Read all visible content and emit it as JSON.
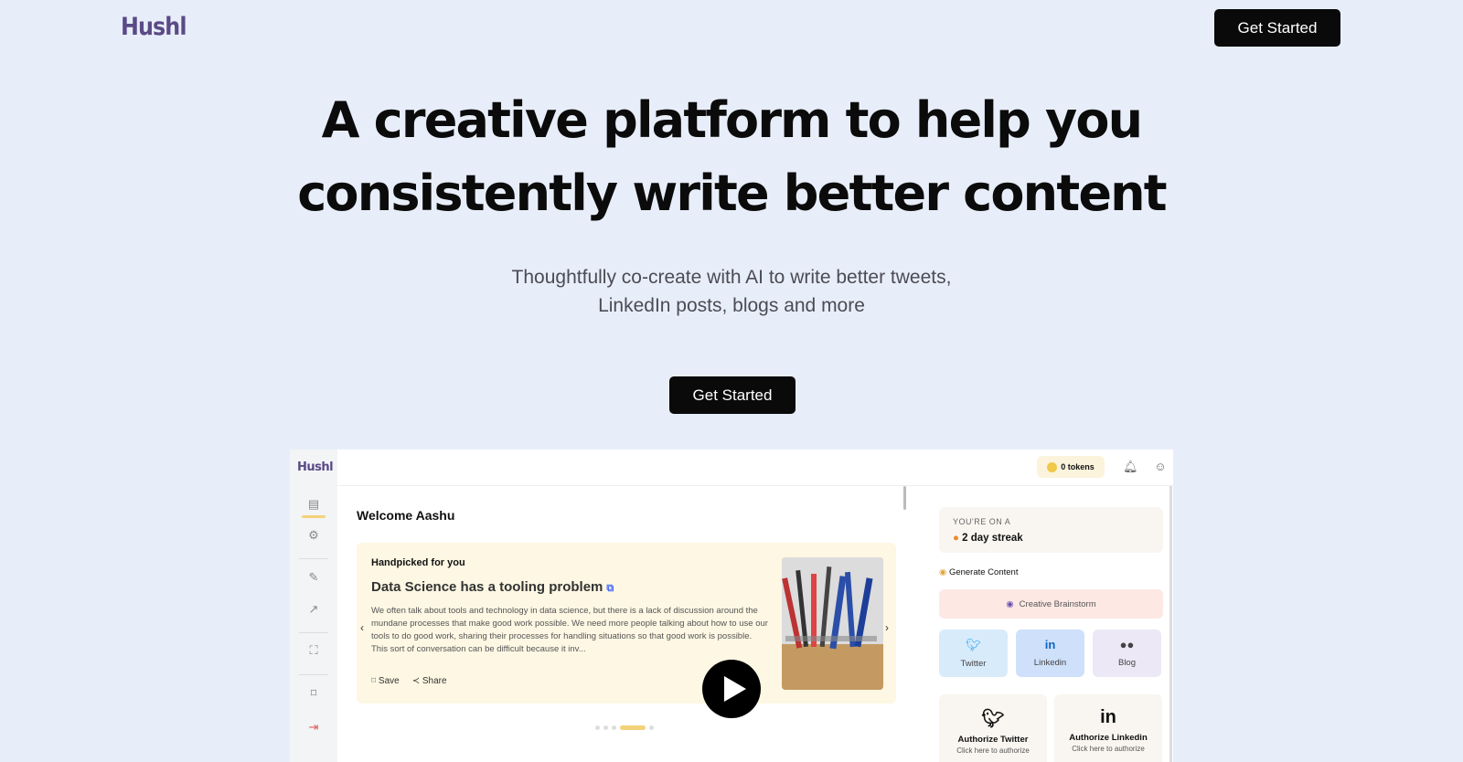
{
  "nav": {
    "logo": "Hushl",
    "cta_label": "Get Started"
  },
  "hero": {
    "title_line1": "A creative platform to help you",
    "title_line2": "consistently write better content",
    "subtitle_line1": "Thoughtfully co-create with AI to write better tweets,",
    "subtitle_line2": "LinkedIn posts, blogs and more",
    "cta_label": "Get Started"
  },
  "app": {
    "logo": "Hushl",
    "tokens": "0 tokens",
    "welcome": "Welcome  Aashu",
    "card": {
      "kicker": "Handpicked for you",
      "title": "Data Science has a tooling problem",
      "body": "We often talk about tools and technology in data science, but there is a lack of discussion around the mundane processes that make good work possible. We need more people talking about how to use our tools to do good work, sharing their processes for handling situations so that good work is possible. This sort of conversation can be difficult because it inv...",
      "save_label": "Save",
      "share_label": "Share"
    },
    "streak": {
      "kicker": "YOU'RE ON A",
      "value": "2 day streak"
    },
    "generate": {
      "heading": "Generate Content",
      "brainstorm": "Creative Brainstorm",
      "tiles": [
        "Twitter",
        "Linkedin",
        "Blog"
      ]
    },
    "authorize": [
      {
        "title": "Authorize Twitter",
        "sub": "Click here to authorize"
      },
      {
        "title": "Authorize Linkedin",
        "sub": "Click here to authorize"
      }
    ]
  },
  "colors": {
    "background": "#e8eef9",
    "brand": "#5a4a86",
    "accent": "#f3d27a"
  }
}
